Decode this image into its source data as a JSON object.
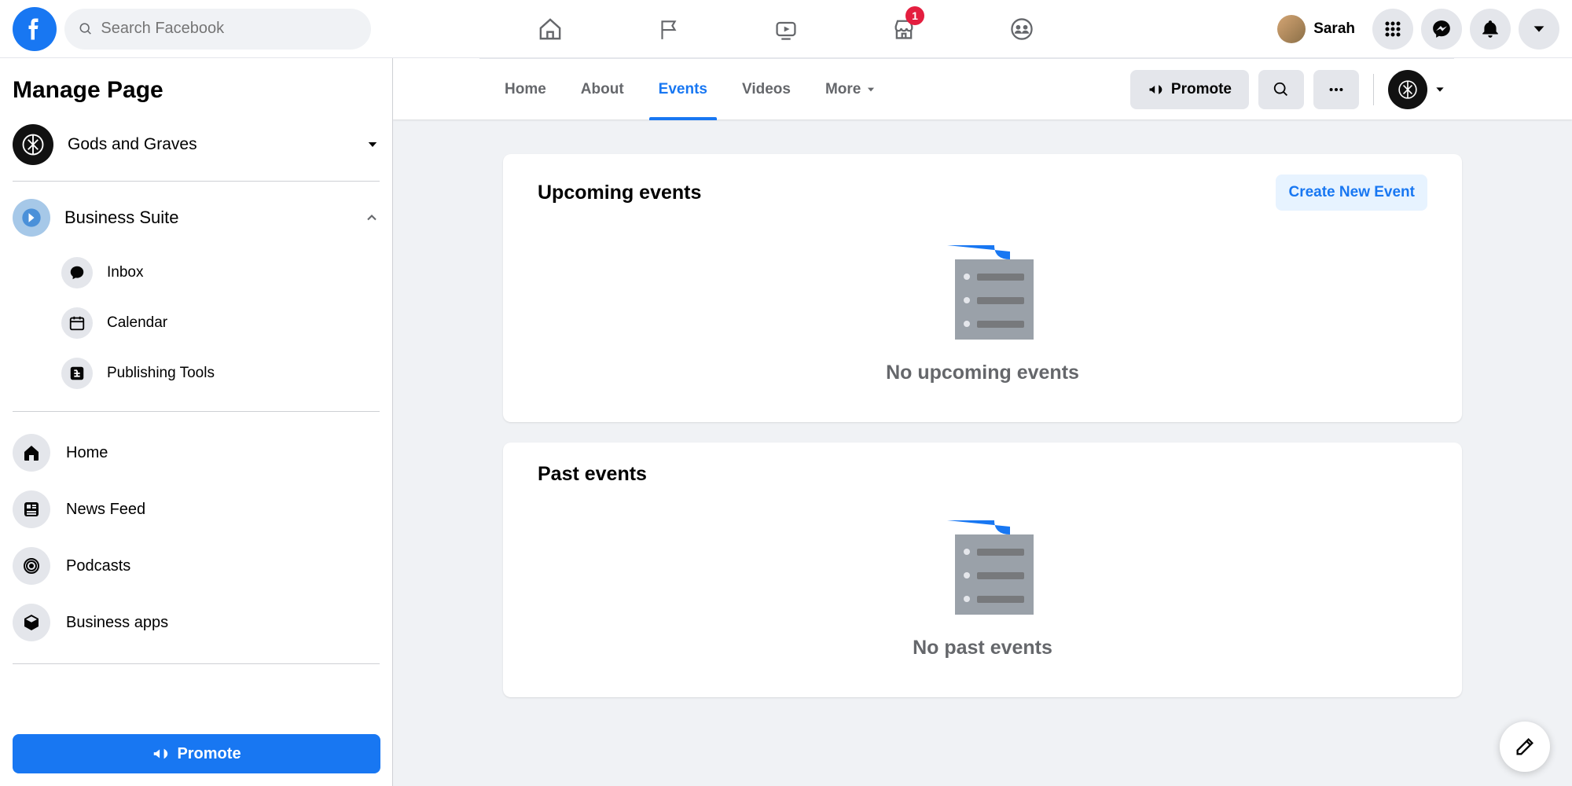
{
  "search": {
    "placeholder": "Search Facebook"
  },
  "topnav": {
    "marketplace_badge": "1"
  },
  "profile": {
    "name": "Sarah"
  },
  "sidebar": {
    "title": "Manage Page",
    "page_name": "Gods and Graves",
    "suite_label": "Business Suite",
    "suite_items": [
      {
        "label": "Inbox"
      },
      {
        "label": "Calendar"
      },
      {
        "label": "Publishing Tools"
      }
    ],
    "nav_items": [
      {
        "label": "Home"
      },
      {
        "label": "News Feed"
      },
      {
        "label": "Podcasts"
      },
      {
        "label": "Business apps"
      }
    ],
    "promote_label": "Promote"
  },
  "tabs": {
    "items": [
      "Home",
      "About",
      "Events",
      "Videos",
      "More"
    ],
    "active_index": 2,
    "promote_label": "Promote"
  },
  "upcoming": {
    "title": "Upcoming events",
    "create_label": "Create New Event",
    "empty_msg": "No upcoming events"
  },
  "past": {
    "title": "Past events",
    "empty_msg": "No past events"
  },
  "colors": {
    "accent": "#1877f2"
  }
}
